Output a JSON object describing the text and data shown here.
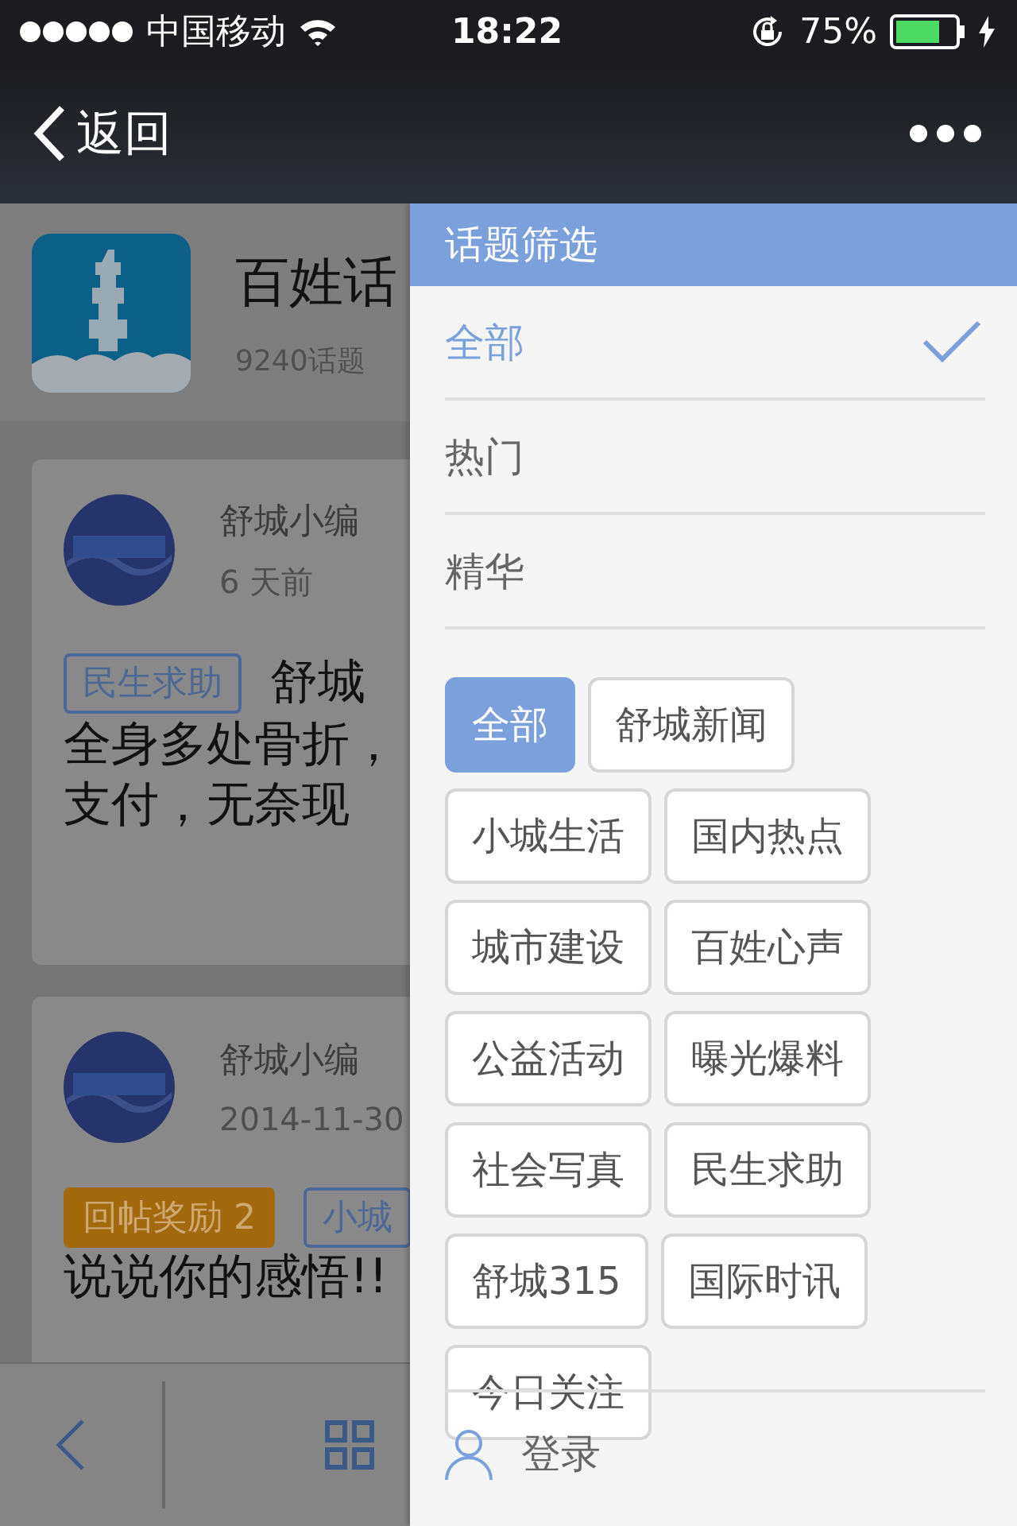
{
  "status_bar": {
    "carrier": "中国移动",
    "time": "18:22",
    "battery_text": "75%"
  },
  "nav": {
    "back": "返回"
  },
  "forum": {
    "title": "百姓话",
    "count": "9240话题"
  },
  "posts": [
    {
      "author": "舒城小编",
      "time": "6 天前",
      "tags": [
        {
          "kind": "category",
          "label": "民生求助"
        }
      ],
      "title": "舒城",
      "lines": [
        "全身多处骨折，",
        "支付，无奈现"
      ]
    },
    {
      "author": "舒城小编",
      "time": "2014-11-30",
      "tags": [
        {
          "kind": "reward",
          "label": "回帖奖励 2"
        },
        {
          "kind": "category",
          "label": "小城"
        }
      ],
      "lines": [
        "说说你的感悟!!"
      ]
    }
  ],
  "filter_panel": {
    "title": "话题筛选",
    "sorts": [
      {
        "label": "全部",
        "selected": true
      },
      {
        "label": "热门",
        "selected": false
      },
      {
        "label": "精华",
        "selected": false
      }
    ],
    "topics": [
      {
        "label": "全部",
        "selected": true
      },
      {
        "label": "舒城新闻",
        "selected": false
      },
      {
        "label": "小城生活",
        "selected": false
      },
      {
        "label": "国内热点",
        "selected": false
      },
      {
        "label": "城市建设",
        "selected": false
      },
      {
        "label": "百姓心声",
        "selected": false
      },
      {
        "label": "公益活动",
        "selected": false
      },
      {
        "label": "曝光爆料",
        "selected": false
      },
      {
        "label": "社会写真",
        "selected": false
      },
      {
        "label": "民生求助",
        "selected": false
      },
      {
        "label": "舒城315",
        "selected": false
      },
      {
        "label": "国际时讯",
        "selected": false
      },
      {
        "label": "今日关注",
        "selected": false
      }
    ],
    "login": "登录"
  }
}
